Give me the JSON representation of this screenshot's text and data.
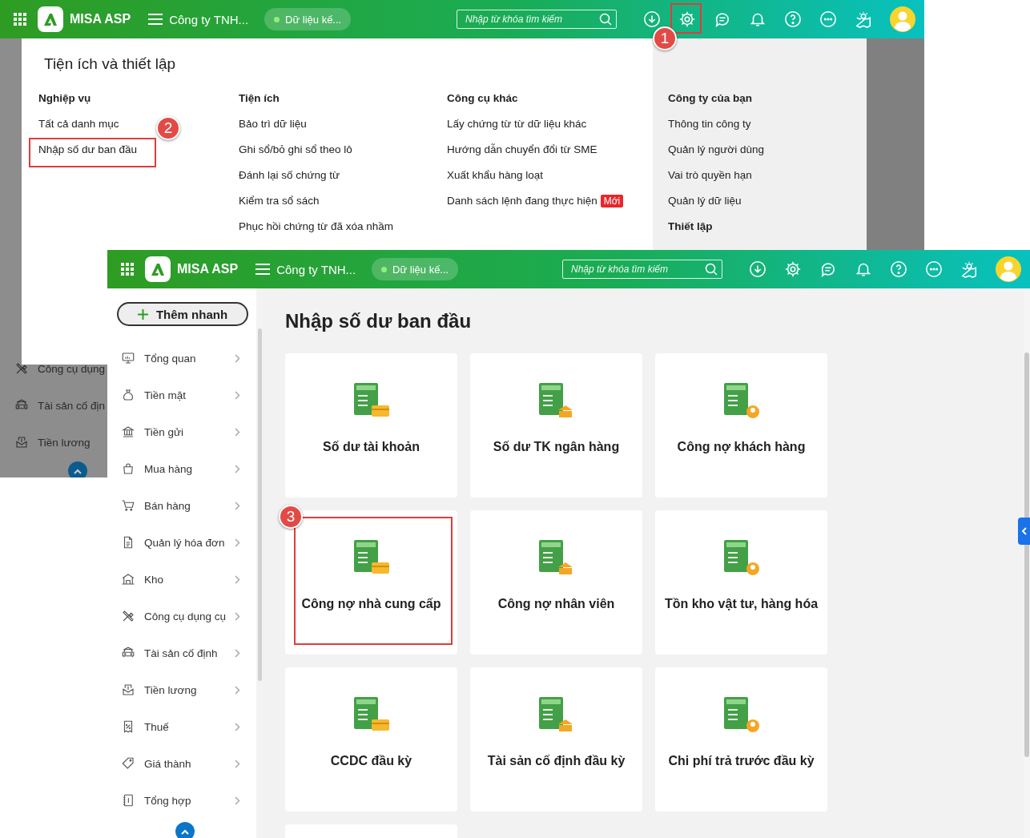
{
  "screenshot_1": {
    "top_bar": {
      "app_name": "MISA ASP",
      "company": "Công ty TNH...",
      "data_status": "Dữ liệu kế...",
      "search": {
        "placeholder": "Nhập từ khóa tìm kiếm"
      },
      "toolbar": [
        {
          "kind": "download"
        },
        {
          "kind": "settings",
          "step": "1"
        },
        {
          "kind": "chat"
        },
        {
          "kind": "notifications"
        },
        {
          "kind": "help"
        },
        {
          "kind": "more"
        },
        {
          "kind": "tips"
        },
        {
          "kind": "account"
        }
      ]
    },
    "settings_menu": {
      "title": "Tiện ích và thiết lập",
      "columns": [
        {
          "heading": "Nghiệp vụ",
          "items": [
            {
              "label": "Tất cả danh mục"
            },
            {
              "label": "Nhập số dư ban đầu",
              "step": "2"
            }
          ]
        },
        {
          "heading": "Tiện ích",
          "items": [
            {
              "label": "Bảo trì dữ liệu"
            },
            {
              "label": "Ghi sổ/bỏ ghi sổ theo lô"
            },
            {
              "label": "Đánh lại số chứng từ"
            },
            {
              "label": "Kiểm tra sổ sách"
            },
            {
              "label": "Phục hồi chứng từ đã xóa nhầm"
            }
          ]
        },
        {
          "heading": "Công cụ khác",
          "items": [
            {
              "label": "Lấy chứng từ từ dữ liệu khác"
            },
            {
              "label": "Hướng dẫn chuyển đổi từ SME"
            },
            {
              "label": "Xuất khẩu hàng loạt"
            },
            {
              "label": "Danh sách lệnh đang thực hiện",
              "badge": "Mới"
            }
          ]
        }
      ],
      "side_panel": [
        {
          "heading": "Công ty của bạn",
          "items": [
            {
              "label": "Thông tin công ty"
            },
            {
              "label": "Quản lý người dùng"
            },
            {
              "label": "Vai trò quyền hạn"
            },
            {
              "label": "Quản lý dữ liệu"
            }
          ]
        },
        {
          "heading": "Thiết lập"
        }
      ]
    },
    "sidebar": {
      "items": [
        "Công cụ dụng",
        "Tài sản cố địn",
        "Tiền lương"
      ]
    }
  },
  "screenshot_2": {
    "top_bar": {
      "app_name": "MISA ASP",
      "company": "Công ty TNH...",
      "data_status": "Dữ liệu kế...",
      "search": {
        "placeholder": "Nhập từ khóa tìm kiếm"
      },
      "toolbar": [
        {
          "kind": "download"
        },
        {
          "kind": "settings"
        },
        {
          "kind": "chat"
        },
        {
          "kind": "notifications"
        },
        {
          "kind": "help"
        },
        {
          "kind": "more"
        },
        {
          "kind": "tips"
        },
        {
          "kind": "account"
        }
      ]
    },
    "sidebar": {
      "quick_add": "Thêm nhanh",
      "items": [
        "Tổng quan",
        "Tiền mặt",
        "Tiền gửi",
        "Mua hàng",
        "Bán hàng",
        "Quản lý hóa đơn",
        "Kho",
        "Công cụ dụng cụ",
        "Tài sản cố định",
        "Tiền lương",
        "Thuế",
        "Giá thành",
        "Tổng hợp"
      ]
    },
    "page": {
      "title": "Nhập số dư ban đầu",
      "cards": [
        {
          "label": "Số dư tài khoản"
        },
        {
          "label": "Số dư TK ngân hàng"
        },
        {
          "label": "Công nợ khách hàng"
        },
        {
          "label": "Công nợ nhà cung cấp",
          "step": "3"
        },
        {
          "label": "Công nợ nhân viên"
        },
        {
          "label": "Tồn kho vật tư, hàng hóa"
        },
        {
          "label": "CCDC đầu kỳ"
        },
        {
          "label": "Tài sản cố định đầu kỳ"
        },
        {
          "label": "Chi phí trả trước đầu kỳ"
        }
      ]
    }
  }
}
